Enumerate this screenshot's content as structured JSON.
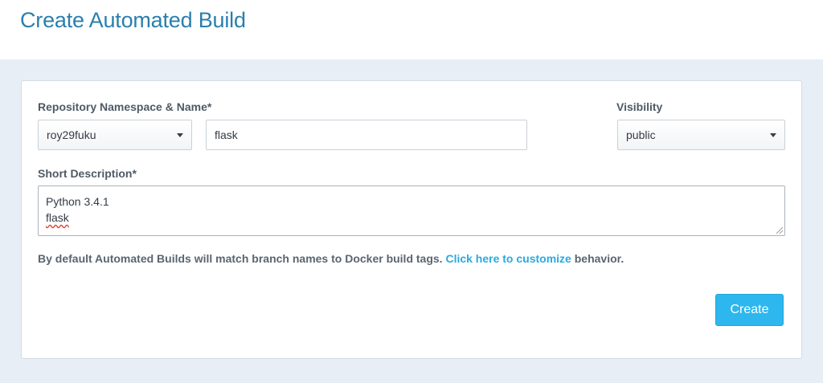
{
  "page": {
    "title": "Create Automated Build"
  },
  "form": {
    "repo_label": "Repository Namespace & Name*",
    "namespace_value": "roy29fuku",
    "name_value": "flask",
    "visibility_label": "Visibility",
    "visibility_value": "public",
    "description_label": "Short Description*",
    "description_lines": [
      "Python 3.4.1",
      "flask"
    ],
    "help_prefix": "By default Automated Builds will match branch names to Docker build tags.",
    "help_link": "Click here to customize",
    "help_suffix": "behavior.",
    "create_label": "Create"
  },
  "colors": {
    "title": "#2a7fad",
    "link": "#2aa9e0",
    "button": "#2db7ee",
    "background": "#e8eef5"
  }
}
